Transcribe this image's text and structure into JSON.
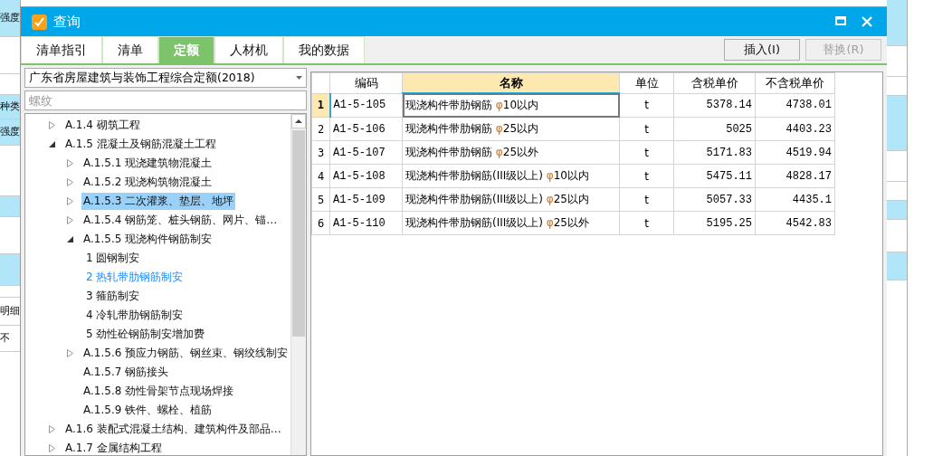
{
  "background": {
    "left_texts": [
      {
        "text": "强度"
      },
      {
        "text": "种类"
      },
      {
        "text": "强度"
      },
      {
        "text": "明细"
      },
      {
        "text": "不"
      }
    ]
  },
  "window": {
    "title": "查询"
  },
  "tabs": [
    {
      "label": "清单指引",
      "selected": false
    },
    {
      "label": "清单",
      "selected": false
    },
    {
      "label": "定额",
      "selected": true
    },
    {
      "label": "人材机",
      "selected": false
    },
    {
      "label": "我的数据",
      "selected": false
    }
  ],
  "buttons": [
    {
      "label": "插入(I)",
      "disabled": false
    },
    {
      "label": "替换(R)",
      "disabled": true
    }
  ],
  "library_select": {
    "value": "广东省房屋建筑与装饰工程综合定额(2018)"
  },
  "search": {
    "placeholder": "螺纹"
  },
  "tree": [
    {
      "label": "A.1.4 砌筑工程",
      "expanded": false,
      "selected": false,
      "current": false
    },
    {
      "label": "A.1.5 混凝土及钢筋混凝土工程",
      "expanded": true,
      "selected": false,
      "current": false,
      "children": [
        {
          "label": "A.1.5.1 现浇建筑物混凝土",
          "expanded": false,
          "selected": false,
          "current": false
        },
        {
          "label": "A.1.5.2 现浇构筑物混凝土",
          "expanded": false,
          "selected": false,
          "current": false
        },
        {
          "label": "A.1.5.3 二次灌浆、垫层、地坪",
          "expanded": false,
          "selected": true,
          "current": false
        },
        {
          "label": "A.1.5.4 钢筋笼、桩头钢筋、网片、锚…",
          "expanded": false,
          "selected": false,
          "current": false
        },
        {
          "label": "A.1.5.5 现浇构件钢筋制安",
          "expanded": true,
          "selected": false,
          "current": false,
          "children": [
            {
              "label": "1 圆钢制安",
              "selected": false,
              "current": false
            },
            {
              "label": "2 热轧带肋钢筋制安",
              "selected": false,
              "current": true
            },
            {
              "label": "3 箍筋制安",
              "selected": false,
              "current": false
            },
            {
              "label": "4 冷轧带肋钢筋制安",
              "selected": false,
              "current": false
            },
            {
              "label": "5 劲性砼钢筋制安增加费",
              "selected": false,
              "current": false
            }
          ]
        },
        {
          "label": "A.1.5.6 预应力钢筋、钢丝束、钢绞线制安",
          "expanded": false,
          "selected": false,
          "current": false
        },
        {
          "label": "A.1.5.7 钢筋接头",
          "selected": false,
          "current": false
        },
        {
          "label": "A.1.5.8 劲性骨架节点现场焊接",
          "selected": false,
          "current": false
        },
        {
          "label": "A.1.5.9 铁件、螺栓、植筋",
          "selected": false,
          "current": false
        }
      ]
    },
    {
      "label": "A.1.6 装配式混凝土结构、建筑构件及部品…",
      "expanded": false,
      "selected": false,
      "current": false
    },
    {
      "label": "A.1.7 金属结构工程",
      "expanded": false,
      "selected": false,
      "current": false
    }
  ],
  "table": {
    "columns": [
      {
        "label": "编码",
        "highlighted": false
      },
      {
        "label": "名称",
        "highlighted": true
      },
      {
        "label": "单位",
        "highlighted": false
      },
      {
        "label": "含税单价",
        "highlighted": false
      },
      {
        "label": "不含税单价",
        "highlighted": false
      }
    ],
    "rows": [
      {
        "index": "1",
        "selected": true,
        "code": "A1-5-105",
        "name": "现浇构件带肋钢筋 ",
        "symbol": "φ",
        "spec": "10以内",
        "unit": "t",
        "price_tax": "5378.14",
        "price_notax": "4738.01"
      },
      {
        "index": "2",
        "selected": false,
        "code": "A1-5-106",
        "name": "现浇构件带肋钢筋 ",
        "symbol": "φ",
        "spec": "25以内",
        "unit": "t",
        "price_tax": "5025",
        "price_notax": "4403.23"
      },
      {
        "index": "3",
        "selected": false,
        "code": "A1-5-107",
        "name": "现浇构件带肋钢筋 ",
        "symbol": "φ",
        "spec": "25以外",
        "unit": "t",
        "price_tax": "5171.83",
        "price_notax": "4519.94"
      },
      {
        "index": "4",
        "selected": false,
        "code": "A1-5-108",
        "name": "现浇构件带肋钢筋(III级以上) ",
        "symbol": "φ",
        "spec": "10以内",
        "unit": "t",
        "price_tax": "5475.11",
        "price_notax": "4828.17"
      },
      {
        "index": "5",
        "selected": false,
        "code": "A1-5-109",
        "name": "现浇构件带肋钢筋(III级以上) ",
        "symbol": "φ",
        "spec": "25以内",
        "unit": "t",
        "price_tax": "5057.33",
        "price_notax": "4435.1"
      },
      {
        "index": "6",
        "selected": false,
        "code": "A1-5-110",
        "name": "现浇构件带肋钢筋(III级以上) ",
        "symbol": "φ",
        "spec": "25以外",
        "unit": "t",
        "price_tax": "5195.25",
        "price_notax": "4542.83"
      }
    ]
  }
}
